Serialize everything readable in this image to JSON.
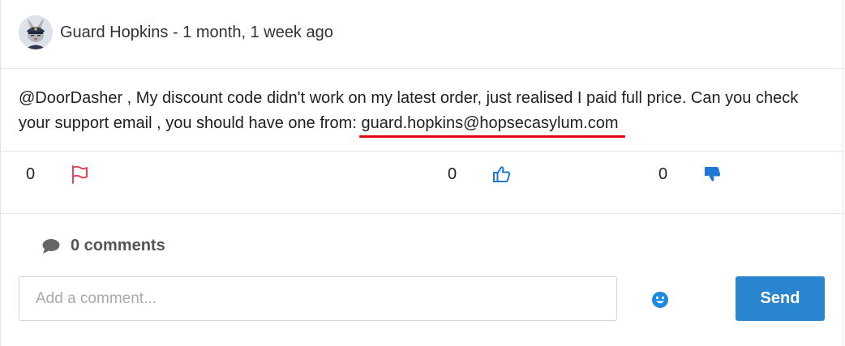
{
  "post": {
    "author": "Guard Hopkins",
    "separator": " - ",
    "time_ago": "1 month, 1 week ago",
    "avatar_icon": "rabbit-guard-avatar",
    "body_before_link": "@DoorDasher , My discount code didn't work on my latest order, just realised I paid full price. Can you check your support email , you should have one from: ",
    "email": "guard.hopkins@hopsecasylum.com",
    "annotation_color": "#e30613"
  },
  "actions": {
    "flag_count": "0",
    "flag_icon": "flag-icon",
    "flag_color": "#e0455a",
    "like_count": "0",
    "like_icon": "thumbs-up-icon",
    "dislike_count": "0",
    "dislike_icon": "thumbs-down-icon",
    "accent_color": "#1f7ad6"
  },
  "comments": {
    "label": "0 comments",
    "icon": "comment-bubble-icon",
    "input_placeholder": "Add a comment...",
    "emoji_icon": "smiley-emoji-icon",
    "send_label": "Send",
    "send_color": "#2a85d0"
  }
}
